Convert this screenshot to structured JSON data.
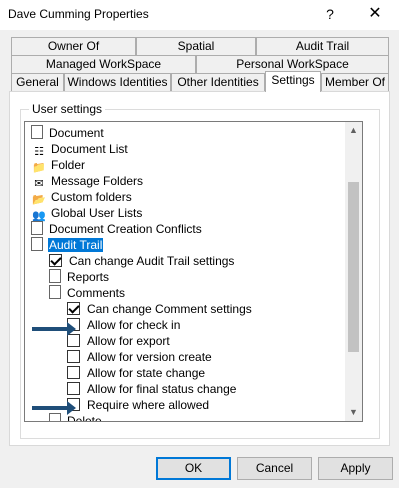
{
  "window": {
    "title": "Dave Cumming Properties",
    "help_glyph": "?",
    "close_glyph": "✕"
  },
  "tabs": {
    "row1": [
      "Owner Of",
      "Spatial",
      "Audit Trail"
    ],
    "row2": [
      "Managed WorkSpace",
      "Personal WorkSpace"
    ],
    "row3": [
      "General",
      "Windows Identities",
      "Other Identities",
      "Settings",
      "Member Of"
    ],
    "active": "Settings"
  },
  "group": {
    "label": "User settings"
  },
  "tree": {
    "items": [
      {
        "label": "Document",
        "type": "doc",
        "checked": false
      },
      {
        "label": "Document List",
        "type": "list",
        "checked": false
      },
      {
        "label": "Folder",
        "type": "folder",
        "checked": false
      },
      {
        "label": "Message Folders",
        "type": "msgfolder",
        "checked": false
      },
      {
        "label": "Custom folders",
        "type": "customfolder",
        "checked": false
      },
      {
        "label": "Global User Lists",
        "type": "userlist",
        "checked": false
      },
      {
        "label": "Document Creation Conflicts",
        "type": "conflicts",
        "checked": false
      },
      {
        "label": "Audit Trail",
        "type": "node",
        "checked": false,
        "selected": true
      },
      {
        "label": "Can change Audit Trail settings",
        "type": "check",
        "checked": true
      },
      {
        "label": "Reports",
        "type": "node",
        "checked": false
      },
      {
        "label": "Comments",
        "type": "node",
        "checked": false
      },
      {
        "label": "Can change Comment settings",
        "type": "check",
        "checked": true
      },
      {
        "label": "Allow for check in",
        "type": "check",
        "checked": false
      },
      {
        "label": "Allow for export",
        "type": "check",
        "checked": false
      },
      {
        "label": "Allow for version create",
        "type": "check",
        "checked": false
      },
      {
        "label": "Allow for state change",
        "type": "check",
        "checked": false
      },
      {
        "label": "Allow for final status change",
        "type": "check",
        "checked": false
      },
      {
        "label": "Require where allowed",
        "type": "check",
        "checked": false
      },
      {
        "label": "Delete",
        "type": "node",
        "checked": false
      }
    ]
  },
  "scroll": {
    "up_glyph": "▲",
    "down_glyph": "▼"
  },
  "buttons": {
    "ok": "OK",
    "cancel": "Cancel",
    "apply": "Apply"
  },
  "colors": {
    "selection": "#0078d7",
    "arrow": "#1f4e79"
  }
}
